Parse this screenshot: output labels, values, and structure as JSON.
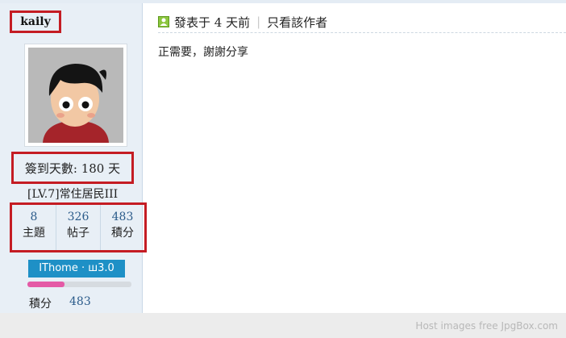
{
  "sidebar": {
    "username": "kaily",
    "signin_text": "簽到天數: 180 天",
    "level": "[LV.7]常住居民III",
    "stats": [
      {
        "value": "8",
        "label": "主題"
      },
      {
        "value": "326",
        "label": "帖子"
      },
      {
        "value": "483",
        "label": "積分"
      }
    ],
    "badge": "IThome · ш3.0",
    "progress_fraction": 0.36,
    "points_label": "積分",
    "points_value": "483"
  },
  "post": {
    "posted": "發表于 4 天前",
    "only_author": "只看該作者",
    "content": "正需要，謝謝分享"
  },
  "footer": {
    "watermark": "Host images free JpgBox.com"
  },
  "colors": {
    "highlight_border": "#c41c23",
    "link": "#2b5b8a",
    "badge_bg": "#1e90c6",
    "progress_fill": "#e45aa6"
  }
}
